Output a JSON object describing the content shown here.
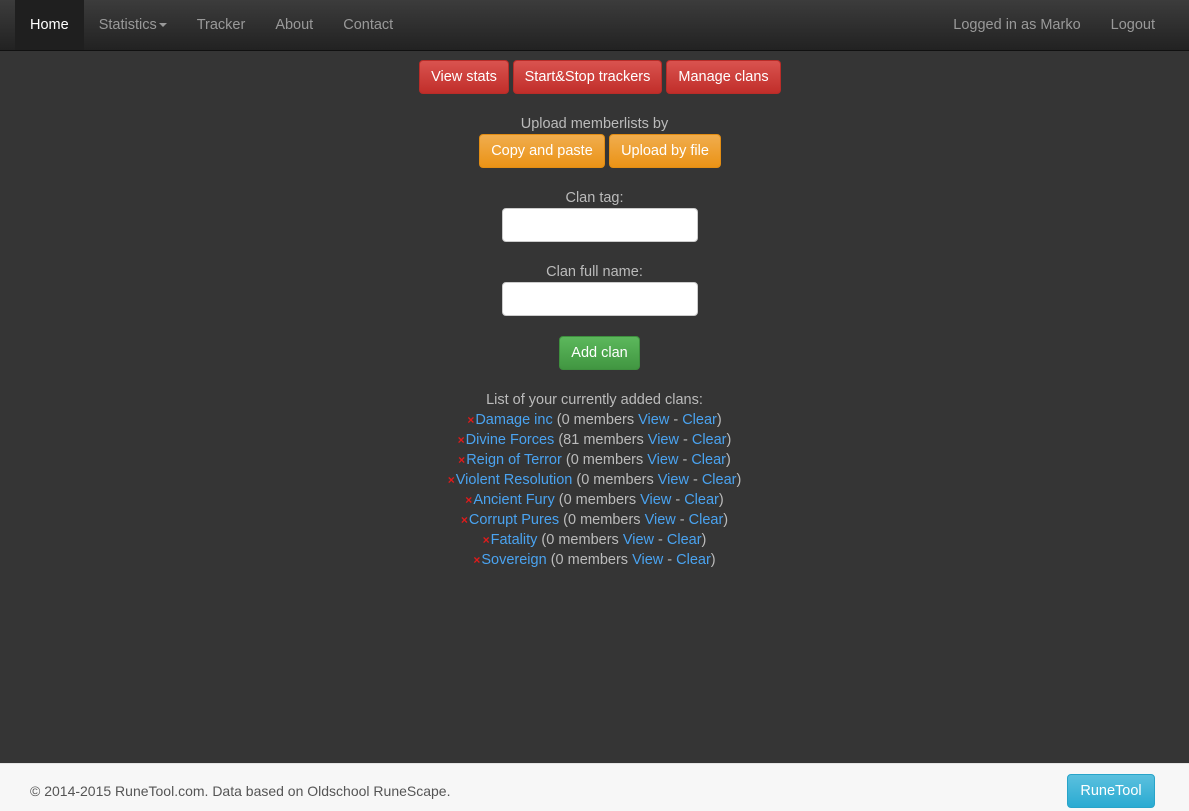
{
  "navbar": {
    "items": [
      {
        "label": "Home"
      },
      {
        "label": "Statistics"
      },
      {
        "label": "Tracker"
      },
      {
        "label": "About"
      },
      {
        "label": "Contact"
      }
    ],
    "user_label": "Logged in as Marko",
    "logout_label": "Logout"
  },
  "actions": {
    "view_stats": "View stats",
    "start_stop": "Start&Stop trackers",
    "manage_clans": "Manage clans"
  },
  "upload": {
    "heading": "Upload memberlists by",
    "copy_paste": "Copy and paste",
    "by_file": "Upload by file"
  },
  "form": {
    "clan_tag_label": "Clan tag:",
    "clan_tag_value": "",
    "clan_name_label": "Clan full name:",
    "clan_name_value": "",
    "add_button": "Add clan"
  },
  "clans": {
    "heading": "List of your currently added clans:",
    "view_label": "View",
    "separator": " - ",
    "clear_label": "Clear",
    "items": [
      {
        "name": "Damage inc",
        "members": "(0 members"
      },
      {
        "name": "Divine Forces",
        "members": "(81 members"
      },
      {
        "name": "Reign of Terror",
        "members": "(0 members"
      },
      {
        "name": "Violent Resolution",
        "members": "(0 members"
      },
      {
        "name": "Ancient Fury",
        "members": "(0 members"
      },
      {
        "name": "Corrupt Pures",
        "members": "(0 members"
      },
      {
        "name": "Fatality",
        "members": "(0 members"
      },
      {
        "name": "Sovereign",
        "members": "(0 members"
      }
    ]
  },
  "footer": {
    "copyright": "© 2014-2015 RuneTool.com. Data based on Oldschool RuneScape.",
    "brand_button": "RuneTool"
  },
  "icons": {
    "remove": "×"
  },
  "colors": {
    "background": "#353535",
    "link": "#4aa3f0",
    "danger": "#d9534f",
    "warning": "#f0ad4e",
    "success": "#5cb85c",
    "info": "#5bc0de"
  }
}
